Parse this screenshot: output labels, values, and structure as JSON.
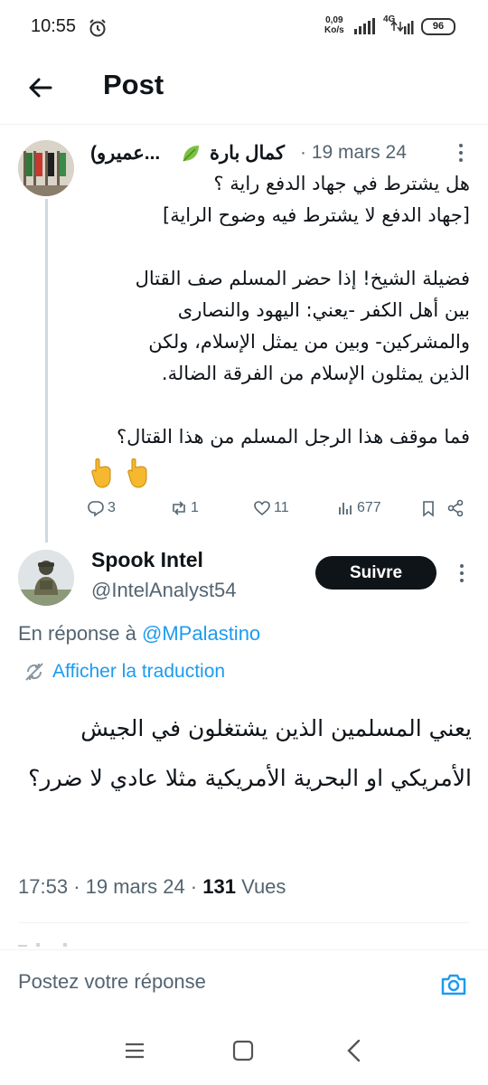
{
  "status_bar": {
    "time": "10:55",
    "net_speed_value": "0,09",
    "net_speed_unit": "Ko/s",
    "network_type": "4G",
    "battery": "96"
  },
  "header": {
    "title": "Post"
  },
  "post1": {
    "author_name": "(عميرو...",
    "author_name2": "كمال بارة",
    "date": "· 19 mars 24",
    "text_lines": [
      "هل يشترط في جهاد الدفع راية ؟",
      "[جهاد الدفع لا يشترط فيه وضوح الراية]",
      "",
      "فضيلة الشيخ! إذا حضر المسلم صف القتال",
      "بين أهل الكفر -يعني: اليهود والنصارى",
      "والمشركين- وبين من يمثل الإسلام، ولكن",
      "الذين يمثلون الإسلام من الفرقة الضالة.",
      "",
      "فما موقف هذا الرجل المسلم من هذا القتال؟"
    ],
    "emoji": "👇👇",
    "replies": "3",
    "reposts": "1",
    "likes": "11",
    "views": "677"
  },
  "post2": {
    "author_name": "Spook Intel",
    "handle": "@IntelAnalyst54",
    "follow_label": "Suivre",
    "reply_prefix": "En réponse à",
    "reply_mention": "@MPalastino",
    "translate_label": "Afficher la traduction",
    "text": "يعني المسلمين الذين يشتغلون في الجيش الأمريكي او البحرية الأمريكية مثلا عادي لا ضرر؟",
    "time": "17:53",
    "date": "· 19 mars 24 ·",
    "views_count": "131",
    "views_label": "Vues"
  },
  "compose": {
    "placeholder": "Postez votre réponse"
  },
  "icons": {
    "back": "arrow-left-icon",
    "more": "more-vertical-icon",
    "reply": "reply-icon",
    "repost": "repost-icon",
    "like": "heart-icon",
    "views": "views-icon",
    "bookmark": "bookmark-icon",
    "share": "share-icon",
    "translate": "translate-icon",
    "camera": "camera-icon"
  },
  "colors": {
    "accent": "#1d9bf0",
    "text": "#0f1419",
    "secondary": "#536471",
    "button": "#0f1419"
  }
}
